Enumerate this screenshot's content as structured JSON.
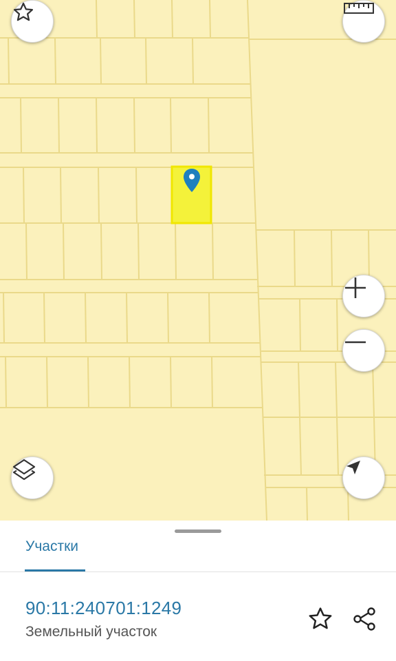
{
  "map": {
    "controls": {
      "favorite_icon": "star-outline-icon",
      "ruler_icon": "ruler-icon",
      "zoom_in_icon": "plus-icon",
      "zoom_out_icon": "minus-icon",
      "layers_icon": "layers-icon",
      "locate_icon": "navigation-arrow-icon"
    },
    "colors": {
      "background": "#fbf1bc",
      "parcel_line": "#ead98a",
      "selected_parcel": "#f4f23a",
      "selected_border": "#f0e600",
      "pin": "#1f7fbe"
    }
  },
  "sheet": {
    "tab_label": "Участки",
    "cadastral_number": "90:11:240701:1249",
    "parcel_type": "Земельный участок",
    "accent": "#2a78a6"
  }
}
